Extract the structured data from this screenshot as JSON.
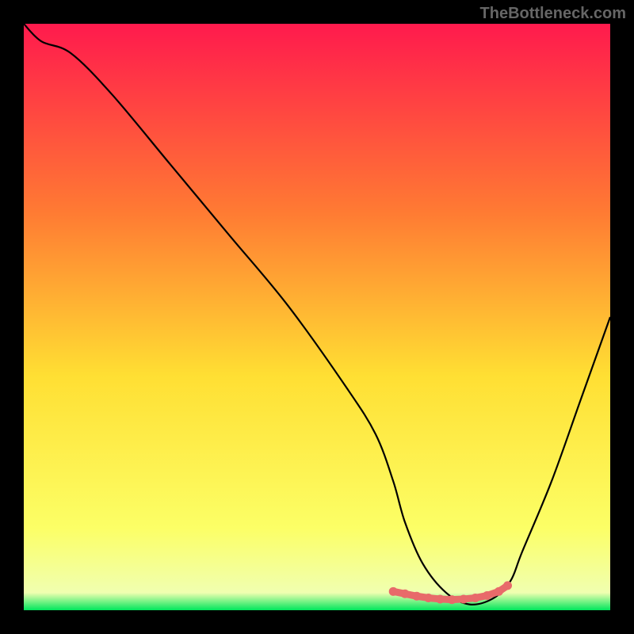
{
  "watermark": "TheBottleneck.com",
  "chart_data": {
    "type": "line",
    "title": "",
    "xlabel": "",
    "ylabel": "",
    "xlim": [
      0,
      100
    ],
    "ylim": [
      0,
      100
    ],
    "gradient_stops": [
      {
        "offset": 0,
        "color": "#ff1a4d"
      },
      {
        "offset": 32,
        "color": "#ff7a33"
      },
      {
        "offset": 60,
        "color": "#ffdf33"
      },
      {
        "offset": 86,
        "color": "#fcff66"
      },
      {
        "offset": 97,
        "color": "#f0ffb0"
      },
      {
        "offset": 100,
        "color": "#00e65c"
      }
    ],
    "series": [
      {
        "name": "bottleneck-curve",
        "color": "#000000",
        "x": [
          0,
          3,
          8,
          15,
          25,
          35,
          45,
          55,
          60,
          63,
          65,
          68,
          72,
          76,
          80,
          83,
          85,
          90,
          95,
          100
        ],
        "y": [
          100,
          97,
          95,
          88,
          76,
          64,
          52,
          38,
          30,
          22,
          15,
          8,
          3,
          1,
          2,
          5,
          10,
          22,
          36,
          50
        ]
      }
    ],
    "markers": {
      "name": "optimal-range",
      "color": "#e86a6a",
      "x": [
        63,
        65,
        67,
        69,
        71,
        73,
        75,
        77,
        79,
        81,
        82.5
      ],
      "y": [
        3.2,
        2.8,
        2.4,
        2.1,
        1.9,
        1.8,
        1.9,
        2.1,
        2.5,
        3.2,
        4.2
      ]
    }
  }
}
